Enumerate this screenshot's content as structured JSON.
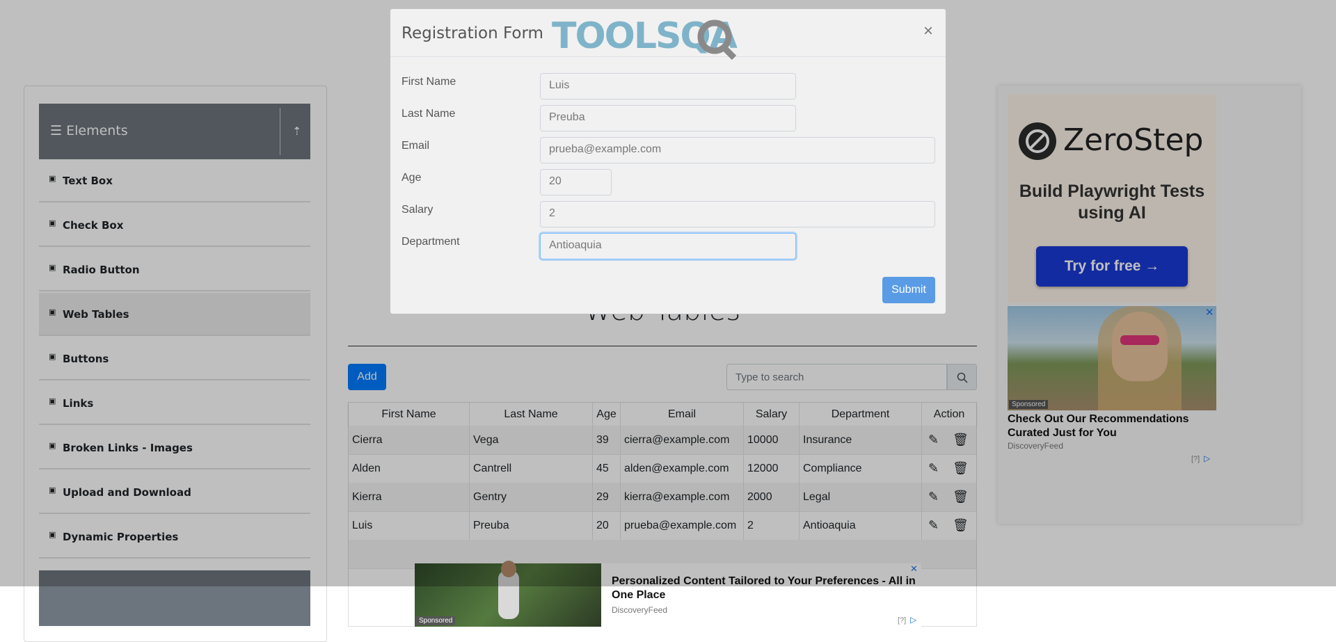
{
  "sidebar": {
    "group_title": "Elements",
    "items": [
      {
        "label": "Text Box"
      },
      {
        "label": "Check Box"
      },
      {
        "label": "Radio Button"
      },
      {
        "label": "Web Tables"
      },
      {
        "label": "Buttons"
      },
      {
        "label": "Links"
      },
      {
        "label": "Broken Links - Images"
      },
      {
        "label": "Upload and Download"
      },
      {
        "label": "Dynamic Properties"
      }
    ],
    "active_item": "Web Tables"
  },
  "main": {
    "title": "Web Tables",
    "add_label": "Add",
    "search_placeholder": "Type to search",
    "table": {
      "columns": [
        "First Name",
        "Last Name",
        "Age",
        "Email",
        "Salary",
        "Department",
        "Action"
      ],
      "rows": [
        {
          "first": "Cierra",
          "last": "Vega",
          "age": "39",
          "email": "cierra@example.com",
          "salary": "10000",
          "dept": "Insurance"
        },
        {
          "first": "Alden",
          "last": "Cantrell",
          "age": "45",
          "email": "alden@example.com",
          "salary": "12000",
          "dept": "Compliance"
        },
        {
          "first": "Kierra",
          "last": "Gentry",
          "age": "29",
          "email": "kierra@example.com",
          "salary": "2000",
          "dept": "Legal"
        },
        {
          "first": "Luis",
          "last": "Preuba",
          "age": "20",
          "email": "prueba@example.com",
          "salary": "2",
          "dept": "Antioaquia"
        }
      ]
    }
  },
  "modal": {
    "title": "Registration Form",
    "logo_text": "TOOLSQA",
    "close": "×",
    "fields": {
      "first_name": {
        "label": "First Name",
        "value": "Luis"
      },
      "last_name": {
        "label": "Last Name",
        "value": "Preuba"
      },
      "email": {
        "label": "Email",
        "value": "prueba@example.com"
      },
      "age": {
        "label": "Age",
        "value": "20"
      },
      "salary": {
        "label": "Salary",
        "value": "2"
      },
      "department": {
        "label": "Department",
        "value": "Antioaquia"
      }
    },
    "submit_label": "Submit"
  },
  "ads": {
    "zerostep": {
      "name": "ZeroStep",
      "tagline": "Build Playwright Tests using AI",
      "cta": "Try for free →"
    },
    "right_card": {
      "sponsored": "Sponsored",
      "title": "Check Out Our Recommendations Curated Just for You",
      "source": "DiscoveryFeed",
      "info": "[?]"
    },
    "bottom": {
      "sponsored": "Sponsored",
      "title": "Personalized Content Tailored to Your Preferences - All in One Place",
      "source": "DiscoveryFeed",
      "info": "[?]"
    }
  },
  "colors": {
    "primary": "#007bff",
    "header": "#6c757d",
    "zerostep_cta": "#1a3ad6"
  }
}
